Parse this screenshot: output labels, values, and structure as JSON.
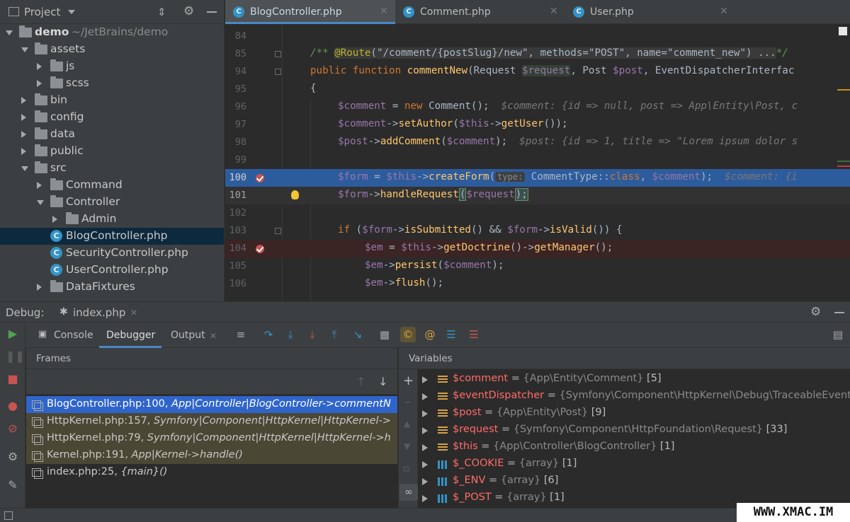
{
  "project": {
    "header_title": "Project",
    "tree": [
      {
        "label": "demo",
        "suffix": "~/JetBrains/demo",
        "level": 0,
        "kind": "folder",
        "state": "open"
      },
      {
        "label": "assets",
        "level": 1,
        "kind": "folder",
        "state": "open"
      },
      {
        "label": "js",
        "level": 2,
        "kind": "folder",
        "state": "closed"
      },
      {
        "label": "scss",
        "level": 2,
        "kind": "folder",
        "state": "closed"
      },
      {
        "label": "bin",
        "level": 1,
        "kind": "folder",
        "state": "closed"
      },
      {
        "label": "config",
        "level": 1,
        "kind": "folder",
        "state": "closed"
      },
      {
        "label": "data",
        "level": 1,
        "kind": "folder",
        "state": "closed"
      },
      {
        "label": "public",
        "level": 1,
        "kind": "folder",
        "state": "closed"
      },
      {
        "label": "src",
        "level": 1,
        "kind": "folder",
        "state": "open"
      },
      {
        "label": "Command",
        "level": 2,
        "kind": "folder",
        "state": "closed"
      },
      {
        "label": "Controller",
        "level": 2,
        "kind": "folder",
        "state": "open"
      },
      {
        "label": "Admin",
        "level": 3,
        "kind": "folder",
        "state": "closed"
      },
      {
        "label": "BlogController.php",
        "level": 3,
        "kind": "class",
        "selected": true
      },
      {
        "label": "SecurityController.php",
        "level": 3,
        "kind": "class"
      },
      {
        "label": "UserController.php",
        "level": 3,
        "kind": "class"
      },
      {
        "label": "DataFixtures",
        "level": 2,
        "kind": "folder",
        "state": "closed"
      }
    ]
  },
  "editor_tabs": [
    {
      "label": "BlogController.php",
      "active": true
    },
    {
      "label": "Comment.php",
      "active": false
    },
    {
      "label": "User.php",
      "active": false
    }
  ],
  "code": {
    "line_numbers": [
      "84",
      "85",
      "94",
      "95",
      "96",
      "97",
      "98",
      "99",
      "100",
      "101",
      "102",
      "103",
      "104",
      "105",
      "106"
    ],
    "l85": {
      "open": "/** ",
      "annotation": "@Route",
      "args": "(\"/comment/{postSlug}/new\", methods=\"POST\", name=\"comment_new\") ...",
      "close": "*/"
    },
    "l94": {
      "kw1": "public ",
      "kw2": "function ",
      "fn": "commentNew",
      "p1": "(Request ",
      "v1": "$request",
      "p2": ", Post ",
      "v2": "$post",
      "p3": ", EventDispatcherInterfac"
    },
    "l95": "{",
    "l96": {
      "v": "$comment",
      "eq": " = ",
      "kw": "new ",
      "rest": "Comment();",
      "hint": "  $comment: {id => null, post => App\\Entity\\Post, c"
    },
    "l97": {
      "v": "$comment",
      "arrow": "->",
      "fn": "setAuthor",
      "p": "(",
      "v2": "$this",
      "arrow2": "->",
      "fn2": "getUser",
      "end": "());"
    },
    "l98": {
      "v": "$post",
      "arrow": "->",
      "fn": "addComment",
      "p": "(",
      "v2": "$comment",
      "end": ");",
      "hint": "  $post: {id => 1, title => \"Lorem ipsum dolor s"
    },
    "l100": {
      "v": "$form",
      "eq": " = ",
      "v2": "$this",
      "arrow": "->",
      "fn": "createForm",
      "p": "(",
      "phint": "type:",
      "cls": " CommentType::",
      "kw": "class",
      "comma": ", ",
      "v3": "$comment",
      "end": ");",
      "hint": "  $comment: {i"
    },
    "l101": {
      "v": "$form",
      "arrow": "->",
      "fn": "handleRequest",
      "p": "(",
      "v2": "$request",
      "end": ");"
    },
    "l103": {
      "kw": "if ",
      "p": "(",
      "v": "$form",
      "arrow": "->",
      "fn": "isSubmitted",
      "mid": "() && ",
      "v2": "$form",
      "arrow2": "->",
      "fn2": "isValid",
      "end": "()) {"
    },
    "l104": {
      "v": "$em",
      "eq": " = ",
      "v2": "$this",
      "arrow": "->",
      "fn": "getDoctrine",
      "mid": "()->",
      "fn2": "getManager",
      "end": "();"
    },
    "l105": {
      "v": "$em",
      "arrow": "->",
      "fn": "persist",
      "p": "(",
      "v2": "$comment",
      "end": ");"
    },
    "l106": {
      "v": "$em",
      "arrow": "->",
      "fn": "flush",
      "end": "();"
    }
  },
  "debug": {
    "title": "Debug:",
    "session": "index.php",
    "tabs": {
      "console": "Console",
      "debugger": "Debugger",
      "output": "Output"
    },
    "frames_title": "Frames",
    "variables_title": "Variables",
    "frames": [
      {
        "file": "BlogController.php:100, ",
        "method": "App|Controller|BlogController->commentN",
        "kind": "selected"
      },
      {
        "file": "HttpKernel.php:157, ",
        "method": "Symfony|Component|HttpKernel|HttpKernel->",
        "kind": "lib"
      },
      {
        "file": "HttpKernel.php:79, ",
        "method": "Symfony|Component|HttpKernel|HttpKernel->h",
        "kind": "lib"
      },
      {
        "file": "Kernel.php:191, ",
        "method": "App|Kernel->handle()",
        "kind": "lib"
      },
      {
        "file": "index.php:25, ",
        "method": "{main}()",
        "kind": "normal"
      }
    ],
    "variables": [
      {
        "name": "$comment",
        "eq": " = ",
        "type": "{App\\Entity\\Comment}",
        "count": " [5]",
        "icon": "obj"
      },
      {
        "name": "$eventDispatcher",
        "eq": " = ",
        "type": "{Symfony\\Component\\HttpKernel\\Debug\\TraceableEvent",
        "count": "",
        "icon": "obj"
      },
      {
        "name": "$post",
        "eq": " = ",
        "type": "{App\\Entity\\Post}",
        "count": " [9]",
        "icon": "obj"
      },
      {
        "name": "$request",
        "eq": " = ",
        "type": "{Symfony\\Component\\HttpFoundation\\Request}",
        "count": " [33]",
        "icon": "obj"
      },
      {
        "name": "$this",
        "eq": " = ",
        "type": "{App\\Controller\\BlogController}",
        "count": " [1]",
        "icon": "obj"
      },
      {
        "name": "$_COOKIE",
        "eq": " = ",
        "type": "{array}",
        "count": " [1]",
        "icon": "arr"
      },
      {
        "name": "$_ENV",
        "eq": " = ",
        "type": "{array}",
        "count": " [6]",
        "icon": "arr"
      },
      {
        "name": "$_POST",
        "eq": " = ",
        "type": "{array}",
        "count": " [1]",
        "icon": "arr"
      }
    ]
  },
  "watermark": "WWW.XMAC.IM",
  "colors": {
    "accent": "#4a88c7",
    "selection": "#2f65ca",
    "breakpoint": "#c75450",
    "variable_name": "#ff6b68"
  }
}
